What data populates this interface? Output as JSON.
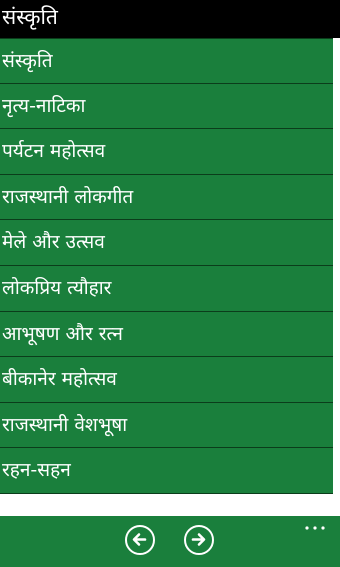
{
  "title_bar": {
    "title": "संस्कृति"
  },
  "menu": {
    "items": [
      {
        "label": "संस्कृति"
      },
      {
        "label": "नृत्य-नाटिका"
      },
      {
        "label": "पर्यटन महोत्सव"
      },
      {
        "label": "राजस्थानी लोकगीत"
      },
      {
        "label": "मेले और उत्सव"
      },
      {
        "label": "लोकप्रिय त्यौहार"
      },
      {
        "label": "आभूषण और रत्न"
      },
      {
        "label": "बीकानेर महोत्सव"
      },
      {
        "label": "राजस्थानी वेशभूषा"
      },
      {
        "label": "रहन-सहन"
      }
    ]
  },
  "app_bar": {
    "back_icon": "arrow-left-circle-icon",
    "forward_icon": "arrow-right-circle-icon",
    "more_icon": "ellipsis-icon"
  },
  "colors": {
    "title_bar_bg": "#000000",
    "list_bg": "#1a7f3c",
    "separator": "#0b3d1b",
    "app_bar_bg": "#1a7f3c",
    "text": "#ffffff"
  }
}
